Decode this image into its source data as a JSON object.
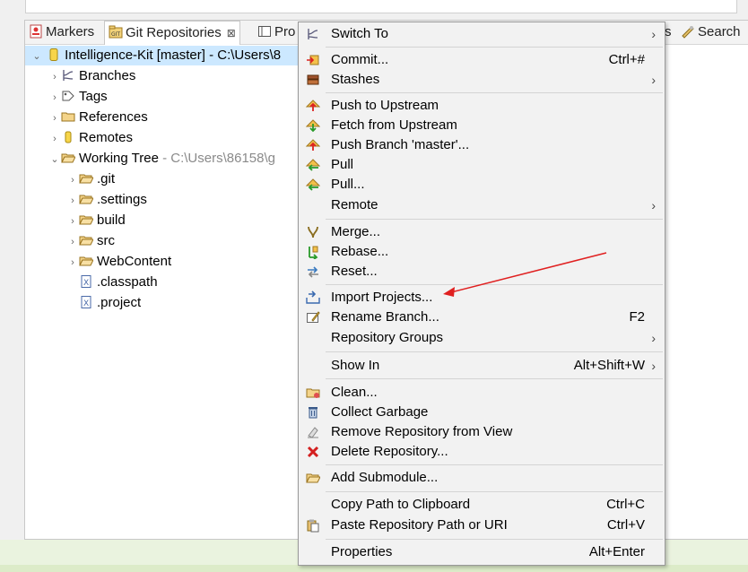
{
  "tabs": [
    {
      "label": "Markers"
    },
    {
      "label": "Git Repositories",
      "close": "⊠"
    },
    {
      "label": "Pro"
    },
    {
      "label": "s"
    },
    {
      "label": "Search"
    }
  ],
  "tree": {
    "repo": {
      "name": "Intelligence-Kit [master] - C:\\Users\\8"
    },
    "items": [
      {
        "label": "Branches"
      },
      {
        "label": "Tags"
      },
      {
        "label": "References"
      },
      {
        "label": "Remotes"
      },
      {
        "label": "Working Tree",
        "path": " - C:\\Users\\86158\\g"
      },
      {
        "label": ".git"
      },
      {
        "label": ".settings"
      },
      {
        "label": "build"
      },
      {
        "label": "src"
      },
      {
        "label": "WebContent"
      },
      {
        "label": ".classpath"
      },
      {
        "label": ".project"
      }
    ]
  },
  "menu": {
    "items": [
      {
        "label": "Switch To",
        "accel": "",
        "sub": "›"
      },
      {
        "label": "Commit...",
        "accel": "Ctrl+#",
        "sub": ""
      },
      {
        "label": "Stashes",
        "accel": "",
        "sub": "›"
      },
      {
        "label": "Push to Upstream",
        "accel": "",
        "sub": ""
      },
      {
        "label": "Fetch from Upstream",
        "accel": "",
        "sub": ""
      },
      {
        "label": "Push Branch 'master'...",
        "accel": "",
        "sub": ""
      },
      {
        "label": "Pull",
        "accel": "",
        "sub": ""
      },
      {
        "label": "Pull...",
        "accel": "",
        "sub": ""
      },
      {
        "label": "Remote",
        "accel": "",
        "sub": "›"
      },
      {
        "label": "Merge...",
        "accel": "",
        "sub": ""
      },
      {
        "label": "Rebase...",
        "accel": "",
        "sub": ""
      },
      {
        "label": "Reset...",
        "accel": "",
        "sub": ""
      },
      {
        "label": "Import Projects...",
        "accel": "",
        "sub": ""
      },
      {
        "label": "Rename Branch...",
        "accel": "F2",
        "sub": ""
      },
      {
        "label": "Repository Groups",
        "accel": "",
        "sub": "›"
      },
      {
        "label": "Show In",
        "accel": "Alt+Shift+W",
        "sub": "›"
      },
      {
        "label": "Clean...",
        "accel": "",
        "sub": ""
      },
      {
        "label": "Collect Garbage",
        "accel": "",
        "sub": ""
      },
      {
        "label": "Remove Repository from View",
        "accel": "",
        "sub": ""
      },
      {
        "label": "Delete Repository...",
        "accel": "",
        "sub": ""
      },
      {
        "label": "Add Submodule...",
        "accel": "",
        "sub": ""
      },
      {
        "label": "Copy Path to Clipboard",
        "accel": "Ctrl+C",
        "sub": ""
      },
      {
        "label": "Paste Repository Path or URI",
        "accel": "Ctrl+V",
        "sub": ""
      },
      {
        "label": "Properties",
        "accel": "Alt+Enter",
        "sub": ""
      }
    ]
  },
  "colors": {
    "selection": "#cce8ff",
    "menu_bg": "#f2f2f2",
    "annotation_arrow": "#e02020"
  },
  "icons": {
    "markers": "markers-icon",
    "git": "git-repositories-icon",
    "annotation": "red-arrow-annotation"
  }
}
